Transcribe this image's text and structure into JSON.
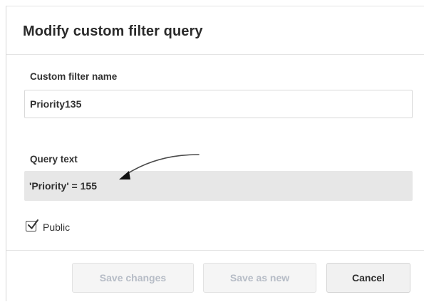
{
  "dialog": {
    "title": "Modify custom filter query"
  },
  "name_field": {
    "label": "Custom filter name",
    "value": "Priority135"
  },
  "query_field": {
    "label": "Query text",
    "value": "'Priority' = 155"
  },
  "public_checkbox": {
    "label": "Public",
    "checked": true
  },
  "footer": {
    "save_changes_label": "Save changes",
    "save_as_new_label": "Save as new",
    "cancel_label": "Cancel"
  },
  "colors": {
    "disabled_text": "#b6bcc6",
    "query_background": "#e7e7e7",
    "title_text": "#2b2b2b"
  },
  "icons": {
    "checkbox": "checkmark-icon",
    "annotation": "arrow-annotation-icon"
  }
}
